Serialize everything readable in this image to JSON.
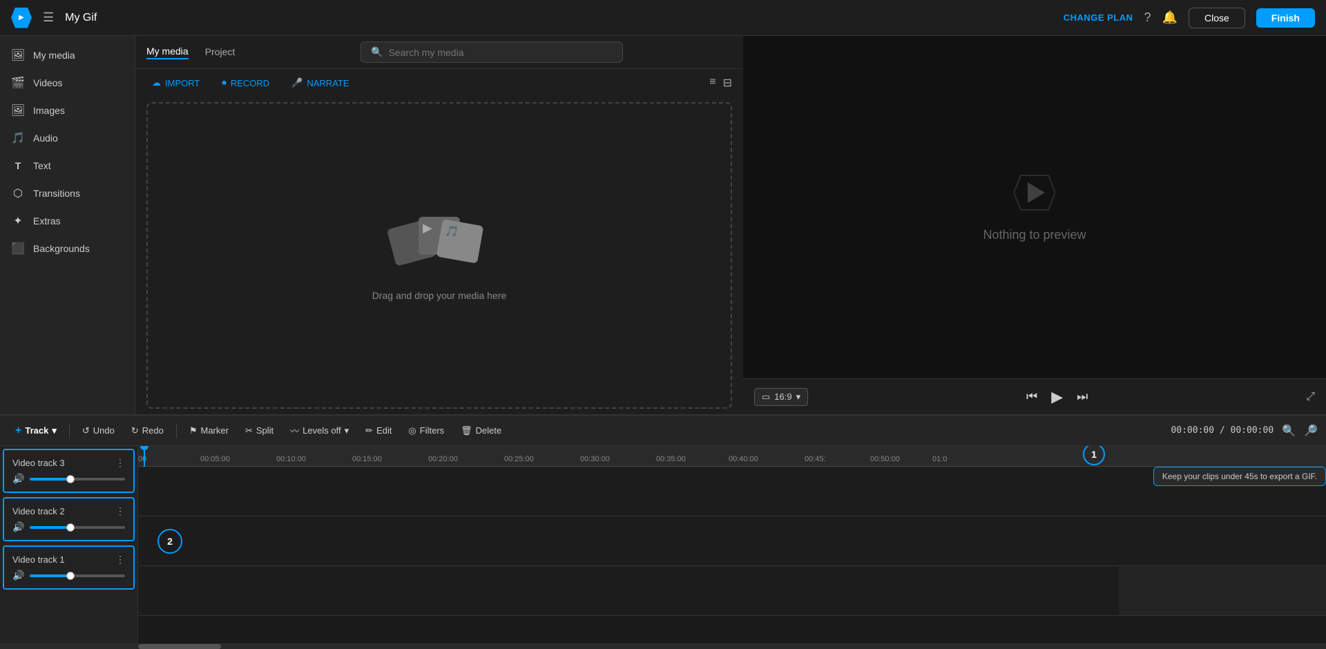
{
  "app": {
    "title": "My Gif",
    "logo_symbol": "▶"
  },
  "topbar": {
    "title": "My Gif",
    "change_plan": "CHANGE PLAN",
    "close_label": "Close",
    "finish_label": "Finish"
  },
  "sidebar": {
    "items": [
      {
        "id": "my-media",
        "label": "My media",
        "icon": "🖼"
      },
      {
        "id": "videos",
        "label": "Videos",
        "icon": "🎬"
      },
      {
        "id": "images",
        "label": "Images",
        "icon": "🖼"
      },
      {
        "id": "audio",
        "label": "Audio",
        "icon": "🎵"
      },
      {
        "id": "text",
        "label": "Text",
        "icon": "T"
      },
      {
        "id": "transitions",
        "label": "Transitions",
        "icon": "⬡"
      },
      {
        "id": "extras",
        "label": "Extras",
        "icon": "✦"
      },
      {
        "id": "backgrounds",
        "label": "Backgrounds",
        "icon": "⬛"
      }
    ]
  },
  "media_panel": {
    "tab_my_media": "My media",
    "tab_project": "Project",
    "search_placeholder": "Search my media",
    "import_label": "IMPORT",
    "record_label": "RECORD",
    "narrate_label": "NARRATE",
    "drop_text": "Drag and drop your media here"
  },
  "preview": {
    "nothing_text": "Nothing to preview",
    "aspect_ratio": "16:9"
  },
  "timeline": {
    "track_label": "Track",
    "undo_label": "Undo",
    "redo_label": "Redo",
    "marker_label": "Marker",
    "split_label": "Split",
    "levels_off_label": "Levels off",
    "edit_label": "Edit",
    "filters_label": "Filters",
    "delete_label": "Delete",
    "time_display": "00:00:00 / 00:00:00",
    "tooltip_export": "Keep your clips under 45s to export a GIF.",
    "ruler_marks": [
      "00:05:00",
      "00:10:00",
      "00:15:00",
      "00:20:00",
      "00:25:00",
      "00:30:00",
      "00:35:00",
      "00:40:00",
      "00:45:00",
      "00:50:00",
      "01:0"
    ],
    "tracks": [
      {
        "name": "Video track 3"
      },
      {
        "name": "Video track 2"
      },
      {
        "name": "Video track 1"
      }
    ],
    "annotation_1": "1",
    "annotation_2": "2"
  }
}
